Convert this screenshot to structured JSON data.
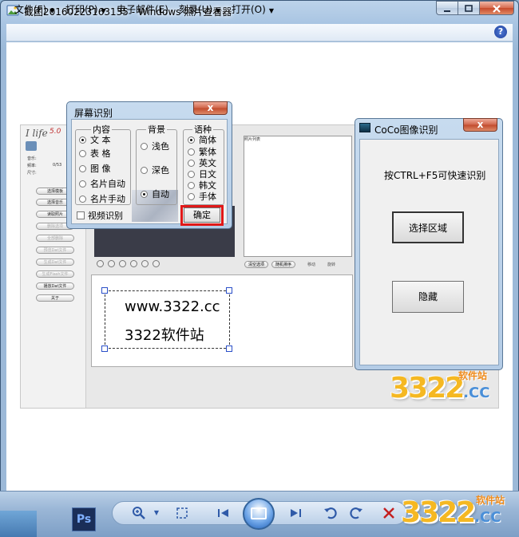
{
  "window": {
    "title": "截图20160223163135 - Windows 照片查看器"
  },
  "menu": {
    "items": [
      {
        "label": "文件(F)"
      },
      {
        "label": "打印(P)"
      },
      {
        "label": "电子邮件(E)"
      },
      {
        "label": "刻录(U)"
      },
      {
        "label": "打开(O)"
      }
    ],
    "help": "?"
  },
  "ilife": {
    "logo": "I life",
    "version": "5.0",
    "fields": [
      "音乐:",
      "频率:",
      "尺寸:"
    ],
    "value": "0/53",
    "buttons": [
      {
        "label": "选择模板",
        "enabled": true
      },
      {
        "label": "选择音乐",
        "enabled": true
      },
      {
        "label": "读取照片",
        "enabled": true
      },
      {
        "label": "删除选项",
        "enabled": false
      },
      {
        "label": "全部删除",
        "enabled": false
      },
      {
        "label": "预览Dat文件",
        "enabled": false
      },
      {
        "label": "生成Dat文件",
        "enabled": false
      },
      {
        "label": "生成Flash文件",
        "enabled": false
      },
      {
        "label": "播放Dat文件",
        "enabled": true
      },
      {
        "label": "关于",
        "enabled": true
      }
    ],
    "photo_list_header": "照片列表",
    "photo_list_buttons": [
      "清空选项",
      "随机排序"
    ],
    "photo_list_labels": [
      "移动",
      "旋转"
    ]
  },
  "document": {
    "line1": "www.3322.cc",
    "line2": "3322软件站"
  },
  "screen_dialog": {
    "title": "屏幕识别",
    "close": "x",
    "content_group": "内容",
    "content_options": [
      {
        "label": "文  本",
        "selected": true
      },
      {
        "label": "表  格",
        "selected": false
      },
      {
        "label": "图  像",
        "selected": false
      },
      {
        "label": "名片自动",
        "selected": false
      },
      {
        "label": "名片手动",
        "selected": false
      }
    ],
    "background_group": "背景",
    "background_options": [
      {
        "label": "浅色",
        "selected": false
      },
      {
        "label": "深色",
        "selected": false
      },
      {
        "label": "自动",
        "selected": true
      }
    ],
    "language_group": "语种",
    "language_options": [
      {
        "label": "简体",
        "selected": true
      },
      {
        "label": "繁体",
        "selected": false
      },
      {
        "label": "英文",
        "selected": false
      },
      {
        "label": "日文",
        "selected": false
      },
      {
        "label": "韩文",
        "selected": false
      },
      {
        "label": "手体",
        "selected": false
      }
    ],
    "video_checkbox": "视频识别",
    "ok": "确定"
  },
  "coco_dialog": {
    "title": "CoCo图像识别",
    "close": "x",
    "hint": "按CTRL+F5可快速识别",
    "select_area": "选择区域",
    "hide": "隐藏"
  },
  "watermark": {
    "digits": "3322",
    "cc": ".CC",
    "site": "软件站"
  },
  "toolbar": {
    "ps_label": "Ps"
  }
}
